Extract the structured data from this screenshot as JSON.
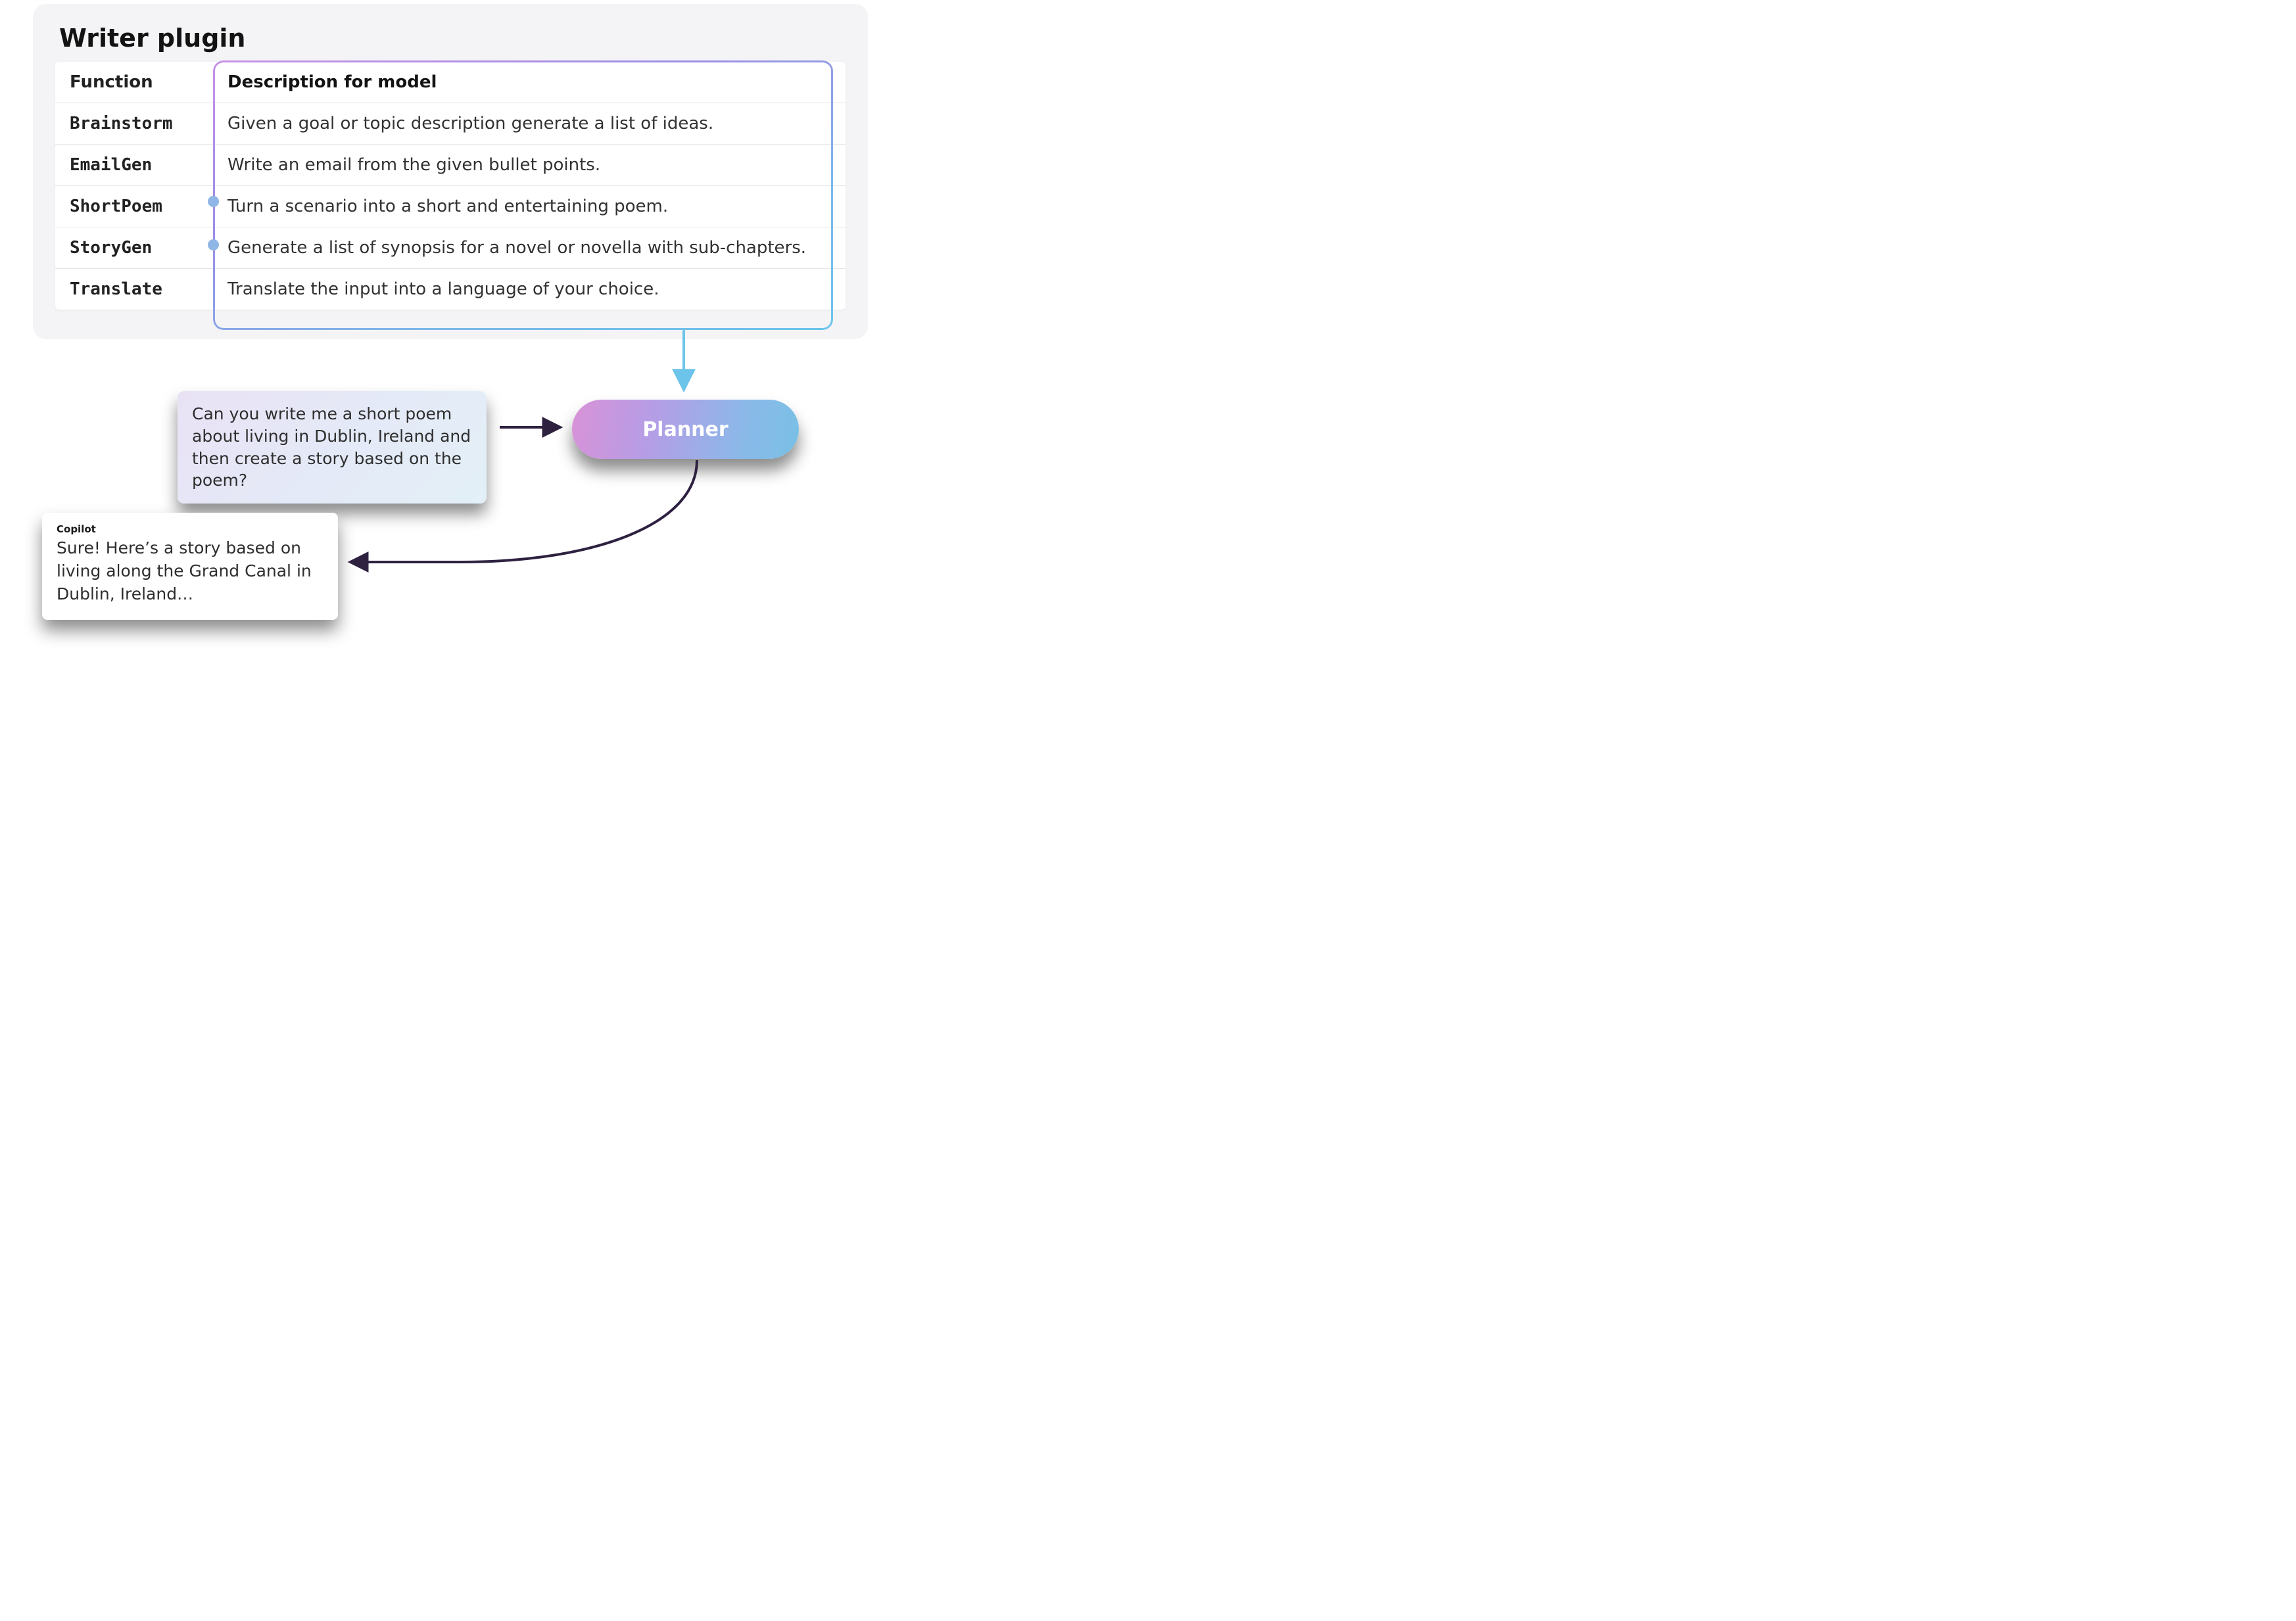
{
  "plugin": {
    "title": "Writer plugin",
    "header": {
      "fn": "Function",
      "desc": "Description for model"
    },
    "rows": [
      {
        "fn": "Brainstorm",
        "desc": "Given a goal or topic description generate a list of ideas."
      },
      {
        "fn": "EmailGen",
        "desc": "Write an email from the given bullet points."
      },
      {
        "fn": "ShortPoem",
        "desc": "Turn a scenario into a short and entertaining poem."
      },
      {
        "fn": "StoryGen",
        "desc": "Generate a list of synopsis for a novel or novella with sub-chapters."
      },
      {
        "fn": "Translate",
        "desc": "Translate the input into a language of your choice."
      }
    ]
  },
  "prompt": {
    "text": "Can you write me a short poem about living in Dublin, Ireland and then create a story based on the poem?"
  },
  "planner": {
    "label": "Planner"
  },
  "response": {
    "author": "Copilot",
    "text": "Sure! Here’s a story based on living along the Grand Canal in Dublin, Ireland…"
  }
}
